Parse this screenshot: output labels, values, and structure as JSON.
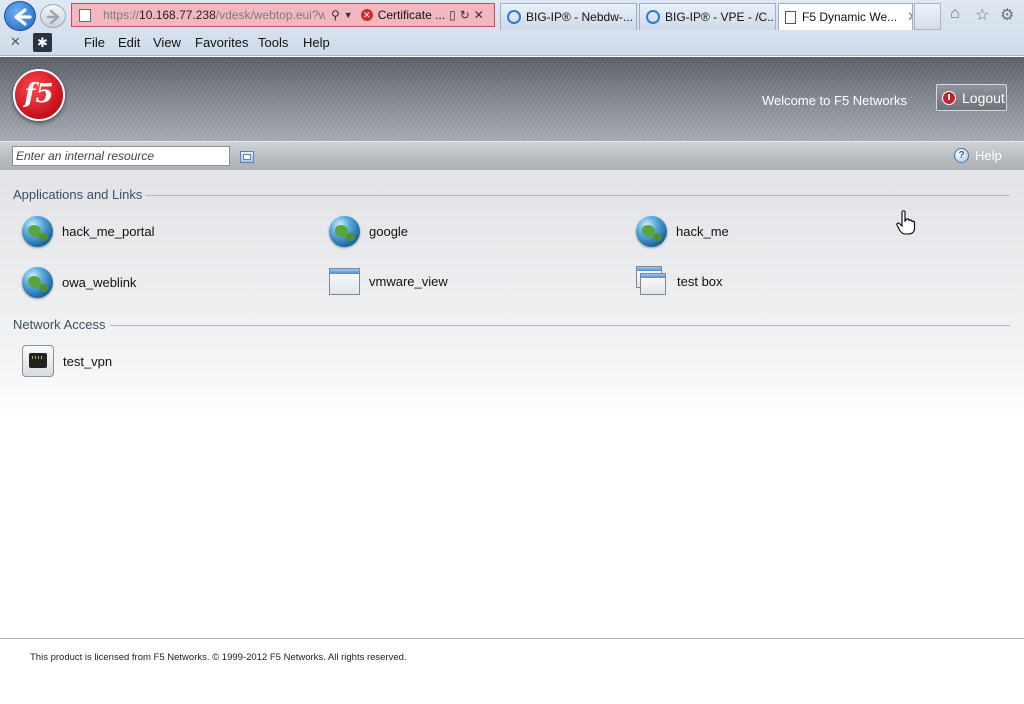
{
  "browser": {
    "address": {
      "url_prefix": "https://",
      "url_host": "10.168.77.238",
      "url_path": "/vdesk/webtop.eui?w",
      "cert_label": "Certificate ..."
    },
    "tabs": [
      {
        "label": "BIG-IP® - Nebdw-..."
      },
      {
        "label": "BIG-IP® - VPE - /C..."
      },
      {
        "label": "F5 Dynamic We..."
      }
    ],
    "menu": [
      "File",
      "Edit",
      "View",
      "Favorites",
      "Tools",
      "Help"
    ]
  },
  "header": {
    "logo_text": "f5",
    "welcome": "Welcome to F5 Networks",
    "logout_label": "Logout"
  },
  "toolbar": {
    "resource_placeholder": "Enter an internal resource",
    "help_label": "Help"
  },
  "sections": {
    "apps_title": "Applications and Links",
    "network_title": "Network Access"
  },
  "apps": [
    {
      "label": "hack_me_portal",
      "icon": "globe-icon"
    },
    {
      "label": "google",
      "icon": "globe-icon"
    },
    {
      "label": "hack_me",
      "icon": "globe-icon"
    },
    {
      "label": "owa_weblink",
      "icon": "globe-icon"
    },
    {
      "label": "vmware_view",
      "icon": "window-icon"
    },
    {
      "label": "test box",
      "icon": "windows-stack-icon"
    }
  ],
  "network": [
    {
      "label": "test_vpn",
      "icon": "network-port-icon"
    }
  ],
  "footer": {
    "text": "This product is licensed from F5 Networks. © 1999-2012 F5 Networks. All rights reserved."
  }
}
